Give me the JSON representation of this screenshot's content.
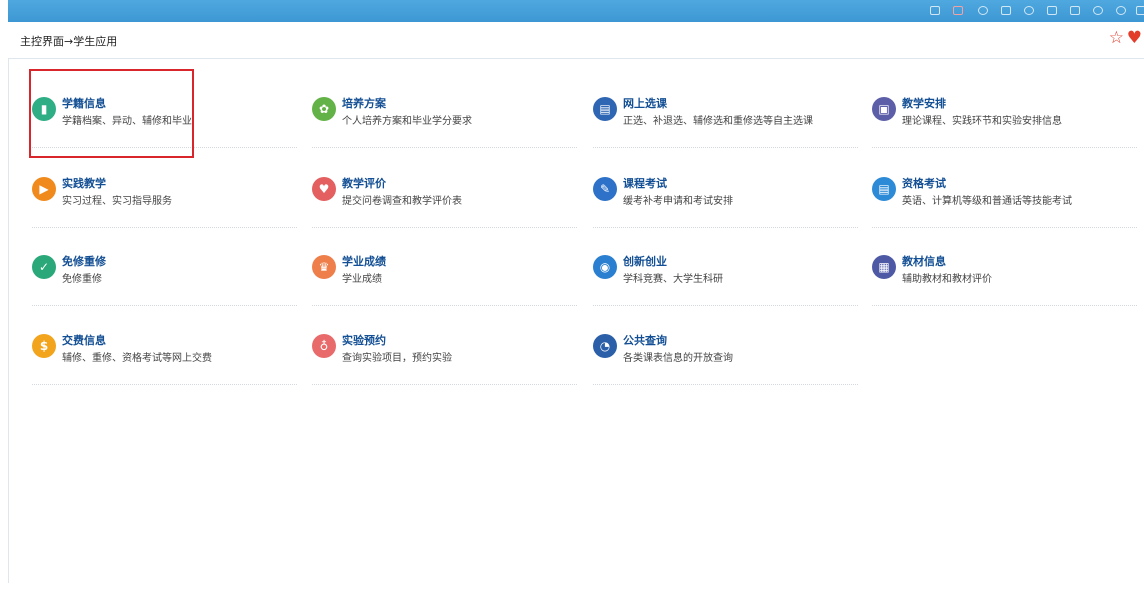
{
  "breadcrumb": "主控界面→学生应用",
  "colors": {
    "topbar": "#3d97d3",
    "title": "#134f94",
    "highlight": "#d9262d",
    "star": "#e23c2a"
  },
  "toolbar_icons": [
    "grid-icon",
    "book-icon",
    "search-icon",
    "window-icon",
    "refresh-icon",
    "list-icon",
    "chat-icon",
    "user-icon",
    "settings-icon",
    "exit-icon"
  ],
  "apps": [
    {
      "title": "学籍信息",
      "desc": "学籍档案、异动、辅修和毕业",
      "icon": "student-record-icon",
      "color": "#2fae86"
    },
    {
      "title": "培养方案",
      "desc": "个人培养方案和毕业学分要求",
      "icon": "plant-icon",
      "color": "#63b247"
    },
    {
      "title": "网上选课",
      "desc": "正选、补退选、辅修选和重修选等自主选课",
      "icon": "course-selection-icon",
      "color": "#2f66b3"
    },
    {
      "title": "教学安排",
      "desc": "理论课程、实践环节和实验安排信息",
      "icon": "schedule-icon",
      "color": "#5c5ea8"
    },
    {
      "title": "实践教学",
      "desc": "实习过程、实习指导服务",
      "icon": "play-icon",
      "color": "#f08a1c"
    },
    {
      "title": "教学评价",
      "desc": "提交问卷调查和教学评价表",
      "icon": "evaluation-icon",
      "color": "#e45f5f"
    },
    {
      "title": "课程考试",
      "desc": "缓考补考申请和考试安排",
      "icon": "exam-icon",
      "color": "#2d72c8"
    },
    {
      "title": "资格考试",
      "desc": "英语、计算机等级和普通话等技能考试",
      "icon": "qualification-icon",
      "color": "#2d8ad6"
    },
    {
      "title": "免修重修",
      "desc": "免修重修",
      "icon": "retake-icon",
      "color": "#2aa879"
    },
    {
      "title": "学业成绩",
      "desc": "学业成绩",
      "icon": "grades-icon",
      "color": "#ee7f4b"
    },
    {
      "title": "创新创业",
      "desc": "学科竞赛、大学生科研",
      "icon": "innovation-icon",
      "color": "#2a7fd1"
    },
    {
      "title": "教材信息",
      "desc": "辅助教材和教材评价",
      "icon": "textbook-icon",
      "color": "#4e59a6"
    },
    {
      "title": "交费信息",
      "desc": "辅修、重修、资格考试等网上交费",
      "icon": "payment-icon",
      "color": "#f2a41d"
    },
    {
      "title": "实验预约",
      "desc": "查询实验项目，预约实验",
      "icon": "experiment-icon",
      "color": "#e86a6a"
    },
    {
      "title": "公共查询",
      "desc": "各类课表信息的开放查询",
      "icon": "query-icon",
      "color": "#2b5fa8"
    }
  ]
}
